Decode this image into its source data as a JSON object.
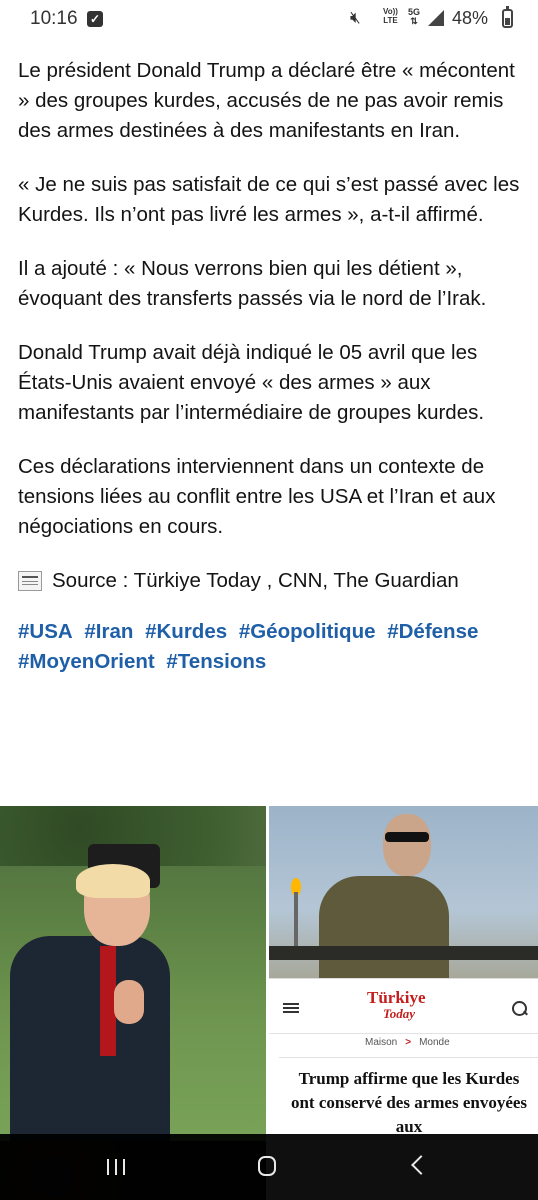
{
  "status_bar": {
    "time": "10:16",
    "volte": "Vo))\nLTE",
    "network": "5G",
    "battery": "48%"
  },
  "article": {
    "paragraphs": [
      "Le président Donald Trump a déclaré être « mécontent » des groupes kurdes, accusés de ne pas avoir remis des armes destinées à des manifestants en Iran.",
      "« Je ne suis pas satisfait de ce qui s’est passé avec les Kurdes. Ils n’ont pas livré les armes », a-t-il affirmé.",
      "Il a ajouté : « Nous verrons bien qui les détient », évoquant des transferts passés via le nord de l’Irak.",
      "Donald Trump avait déjà indiqué  le 05 avril que les États-Unis avaient envoyé « des armes » aux manifestants par l’intermédiaire de groupes kurdes.",
      "Ces déclarations interviennent dans un contexte de tensions liées au conflit entre les USA et l’Iran et aux négociations en cours."
    ],
    "source": "Source : Türkiye Today , CNN, The Guardian",
    "hashtags": [
      "#USA",
      "#Iran",
      "#Kurdes",
      "#Géopolitique",
      "#Défense",
      "#MoyenOrient",
      "#Tensions"
    ]
  },
  "embedded_card": {
    "logo_line1": "Türkiye",
    "logo_line2": "Today",
    "breadcrumb_home": "Maison",
    "breadcrumb_section": "Monde",
    "headline": "Trump affirme que les Kurdes ont conservé des armes envoyées aux"
  },
  "colors": {
    "hashtag": "#1f5fa8",
    "logo": "#c41e1e",
    "navbar": "#000000"
  }
}
